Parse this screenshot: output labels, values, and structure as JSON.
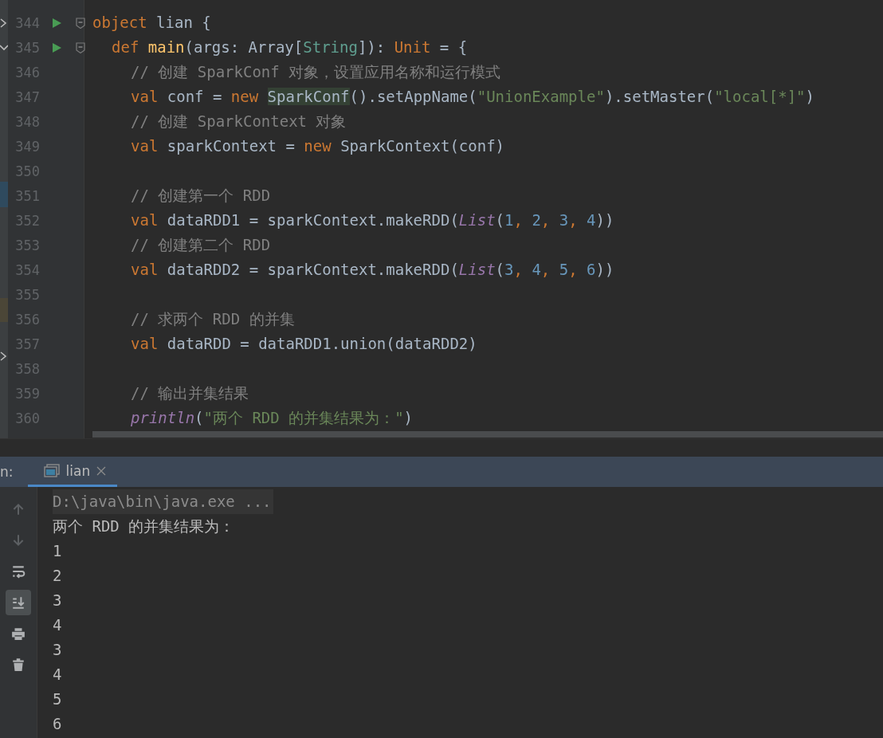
{
  "editor": {
    "lines": [
      {
        "number": "344",
        "run": true,
        "fold": true,
        "tokens": [
          {
            "kind": "kw",
            "text": "object"
          },
          {
            "kind": "plain",
            "text": " lian {"
          }
        ],
        "children": [
          {
            "number": "345",
            "run": true,
            "fold": true,
            "tokens": [
              {
                "kind": "kw",
                "text": "def "
              },
              {
                "kind": "decl",
                "text": "main"
              },
              {
                "kind": "plain",
                "text": "(args: Array["
              },
              {
                "kind": "type",
                "text": "String"
              },
              {
                "kind": "plain",
                "text": "]): "
              },
              {
                "kind": "kw",
                "text": "Unit"
              },
              {
                "kind": "plain",
                "text": " = {"
              }
            ],
            "children": [
              {
                "number": "346",
                "run": false,
                "fold": false,
                "tokens": [
                  {
                    "kind": "comment",
                    "text": "// 创建 SparkConf 对象，设置应用名称和运行模式"
                  }
                ]
              },
              {
                "number": "347",
                "run": false,
                "fold": false,
                "tokens": [
                  {
                    "kind": "kw",
                    "text": "val"
                  },
                  {
                    "kind": "plain",
                    "text": " conf = "
                  },
                  {
                    "kind": "kw",
                    "text": "new "
                  },
                  {
                    "kind": "highlight",
                    "text": "SparkConf"
                  },
                  {
                    "kind": "plain",
                    "text": "().setAppName("
                  },
                  {
                    "kind": "string",
                    "text": "\"UnionExample\""
                  },
                  {
                    "kind": "plain",
                    "text": ").setMaster("
                  },
                  {
                    "kind": "string",
                    "text": "\"local[*]\""
                  },
                  {
                    "kind": "plain",
                    "text": ")"
                  }
                ]
              },
              {
                "number": "348",
                "run": false,
                "fold": false,
                "tokens": [
                  {
                    "kind": "comment",
                    "text": "// 创建 SparkContext 对象"
                  }
                ]
              },
              {
                "number": "349",
                "run": false,
                "fold": false,
                "tokens": [
                  {
                    "kind": "kw",
                    "text": "val"
                  },
                  {
                    "kind": "plain",
                    "text": " sparkContext = "
                  },
                  {
                    "kind": "kw",
                    "text": "new"
                  },
                  {
                    "kind": "plain",
                    "text": " SparkContext(conf)"
                  }
                ]
              },
              {
                "number": "350",
                "run": false,
                "fold": false
              },
              {
                "number": "351",
                "run": false,
                "fold": false,
                "tokens": [
                  {
                    "kind": "comment",
                    "text": "// 创建第一个 RDD"
                  }
                ]
              },
              {
                "number": "352",
                "run": false,
                "fold": false,
                "tokens": [
                  {
                    "kind": "kw",
                    "text": "val"
                  },
                  {
                    "kind": "plain",
                    "text": " dataRDD1 = sparkContext.makeRDD("
                  },
                  {
                    "kind": "call",
                    "text": "List"
                  },
                  {
                    "kind": "plain",
                    "text": "("
                  },
                  {
                    "kind": "number",
                    "text": "1"
                  },
                  {
                    "kind": "kw",
                    "text": ", "
                  },
                  {
                    "kind": "number",
                    "text": "2"
                  },
                  {
                    "kind": "kw",
                    "text": ", "
                  },
                  {
                    "kind": "number",
                    "text": "3"
                  },
                  {
                    "kind": "kw",
                    "text": ", "
                  },
                  {
                    "kind": "number",
                    "text": "4"
                  },
                  {
                    "kind": "plain",
                    "text": "))"
                  }
                ]
              },
              {
                "number": "353",
                "run": false,
                "fold": false,
                "tokens": [
                  {
                    "kind": "comment",
                    "text": "// 创建第二个 RDD"
                  }
                ]
              },
              {
                "number": "354",
                "run": false,
                "fold": false,
                "tokens": [
                  {
                    "kind": "kw",
                    "text": "val"
                  },
                  {
                    "kind": "plain",
                    "text": " dataRDD2 = sparkContext.makeRDD("
                  },
                  {
                    "kind": "call",
                    "text": "List"
                  },
                  {
                    "kind": "plain",
                    "text": "("
                  },
                  {
                    "kind": "number",
                    "text": "3"
                  },
                  {
                    "kind": "kw",
                    "text": ", "
                  },
                  {
                    "kind": "number",
                    "text": "4"
                  },
                  {
                    "kind": "kw",
                    "text": ", "
                  },
                  {
                    "kind": "number",
                    "text": "5"
                  },
                  {
                    "kind": "kw",
                    "text": ", "
                  },
                  {
                    "kind": "number",
                    "text": "6"
                  },
                  {
                    "kind": "plain",
                    "text": "))"
                  }
                ]
              },
              {
                "number": "355",
                "run": false,
                "fold": false
              },
              {
                "number": "356",
                "run": false,
                "fold": false,
                "tokens": [
                  {
                    "kind": "comment",
                    "text": "// 求两个 RDD 的并集"
                  }
                ]
              },
              {
                "number": "357",
                "run": false,
                "fold": false,
                "tokens": [
                  {
                    "kind": "kw",
                    "text": "val"
                  },
                  {
                    "kind": "plain",
                    "text": " dataRDD = dataRDD1.union(dataRDD2)"
                  }
                ]
              },
              {
                "number": "358",
                "run": false,
                "fold": false
              },
              {
                "number": "359",
                "run": false,
                "fold": false,
                "tokens": [
                  {
                    "kind": "comment",
                    "text": "// 输出并集结果"
                  }
                ]
              },
              {
                "number": "360",
                "run": false,
                "fold": false,
                "tokens": [
                  {
                    "kind": "call",
                    "text": "println"
                  },
                  {
                    "kind": "plain",
                    "text": "("
                  },
                  {
                    "kind": "string",
                    "text": "\"两个 RDD 的并集结果为：\""
                  },
                  {
                    "kind": "plain",
                    "text": ")"
                  }
                ]
              }
            ]
          }
        ]
      }
    ]
  },
  "run_panel": {
    "label": "n:",
    "tabs": [
      {
        "label": "lian",
        "selected": true
      }
    ],
    "tools": [
      {
        "kind": "up",
        "selected": false,
        "disabled": true
      },
      {
        "kind": "down",
        "selected": false,
        "disabled": true
      },
      {
        "kind": "wrap",
        "selected": false,
        "disabled": false
      },
      {
        "kind": "scroll-end",
        "selected": true,
        "disabled": false
      },
      {
        "kind": "print",
        "selected": false,
        "disabled": false
      },
      {
        "kind": "trash",
        "selected": false,
        "disabled": false
      }
    ],
    "output": [
      {
        "kind": "command",
        "text": "D:\\java\\bin\\java.exe ..."
      },
      {
        "kind": "out",
        "text": "两个 RDD 的并集结果为："
      },
      {
        "kind": "out",
        "text": "1"
      },
      {
        "kind": "out",
        "text": "2"
      },
      {
        "kind": "out",
        "text": "3"
      },
      {
        "kind": "out",
        "text": "4"
      },
      {
        "kind": "out",
        "text": "3"
      },
      {
        "kind": "out",
        "text": "4"
      },
      {
        "kind": "out",
        "text": "5"
      },
      {
        "kind": "out",
        "text": "6"
      }
    ]
  }
}
